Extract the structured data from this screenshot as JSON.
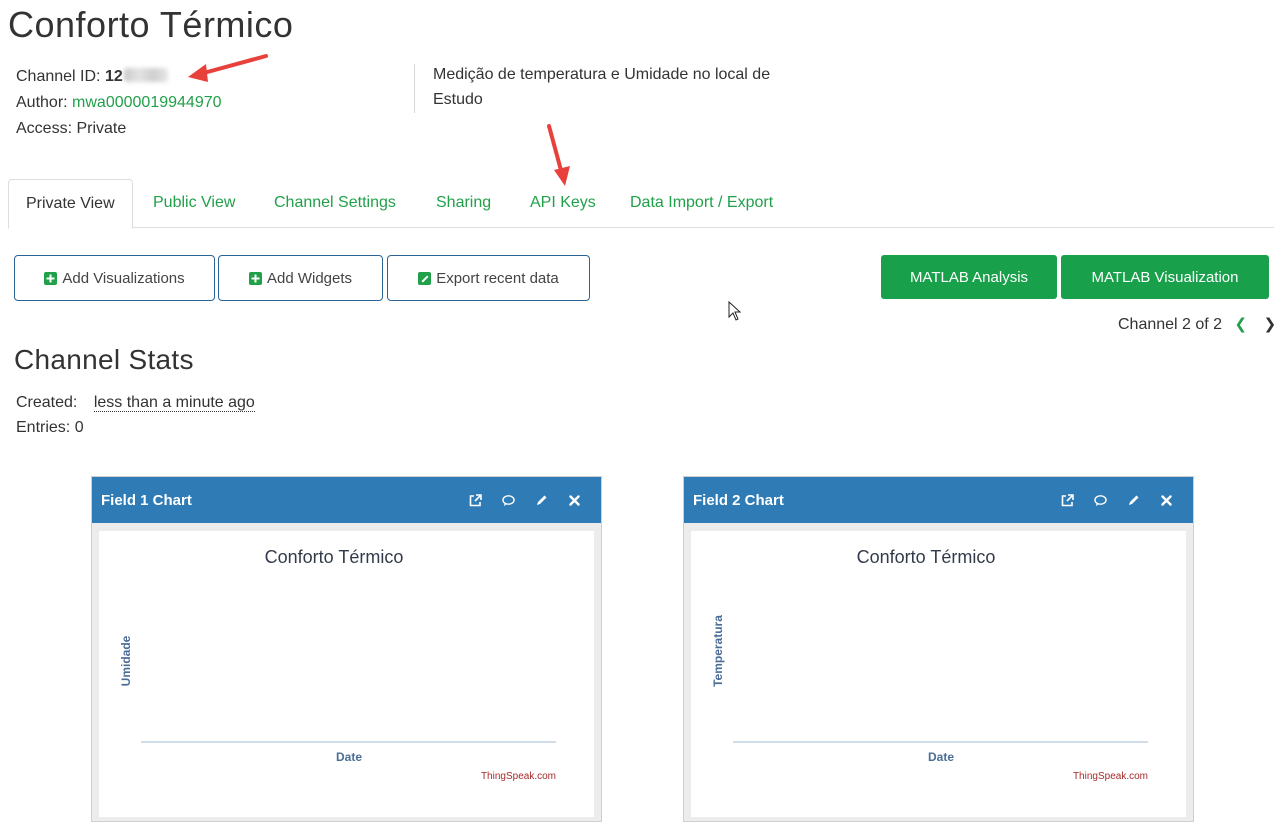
{
  "page_title": "Conforto Térmico",
  "channel": {
    "channel_id_label": "Channel ID:",
    "channel_id_visible": "12",
    "author_label": "Author:",
    "author": "mwa0000019944970",
    "access_label": "Access:",
    "access": "Private",
    "description": "Medição de temperatura e Umidade no local de Estudo"
  },
  "tabs": [
    {
      "label": "Private View",
      "active": true
    },
    {
      "label": "Public View"
    },
    {
      "label": "Channel Settings"
    },
    {
      "label": "Sharing"
    },
    {
      "label": "API Keys"
    },
    {
      "label": "Data Import / Export"
    }
  ],
  "actions": {
    "add_visualizations": "Add Visualizations",
    "add_widgets": "Add Widgets",
    "export_recent_data": "Export recent data",
    "matlab_analysis": "MATLAB Analysis",
    "matlab_visualization": "MATLAB Visualization"
  },
  "pager": {
    "text": "Channel 2 of 2",
    "prev_icon": "chevron-left-icon",
    "next_icon": "chevron-right-icon"
  },
  "stats": {
    "title": "Channel Stats",
    "created_label": "Created:",
    "created_value": "less than a minute ago",
    "entries_label": "Entries:",
    "entries_value": "0"
  },
  "panels": [
    {
      "title": "Field 1 Chart",
      "icons": [
        "external-link-icon",
        "comment-icon",
        "pencil-icon",
        "close-icon"
      ],
      "chart_title": "Conforto Térmico",
      "ylabel": "Umidade",
      "xlabel": "Date",
      "credit": "ThingSpeak.com"
    },
    {
      "title": "Field 2 Chart",
      "icons": [
        "external-link-icon",
        "comment-icon",
        "pencil-icon",
        "close-icon"
      ],
      "chart_title": "Conforto Térmico",
      "ylabel": "Temperatura",
      "xlabel": "Date",
      "credit": "ThingSpeak.com"
    }
  ],
  "chart_data": [
    {
      "type": "line",
      "title": "Conforto Térmico",
      "xlabel": "Date",
      "ylabel": "Umidade",
      "series": [],
      "grid": false
    },
    {
      "type": "line",
      "title": "Conforto Térmico",
      "xlabel": "Date",
      "ylabel": "Temperatura",
      "series": [],
      "grid": false
    }
  ],
  "colors": {
    "accent_green": "#21a04a",
    "button_green": "#18a04a",
    "panel_header_blue": "#2f7bb5",
    "annotation_arrow_red": "#e8403b",
    "axis_label_blue": "#4a6d97",
    "credit_red": "#a52a2a"
  }
}
